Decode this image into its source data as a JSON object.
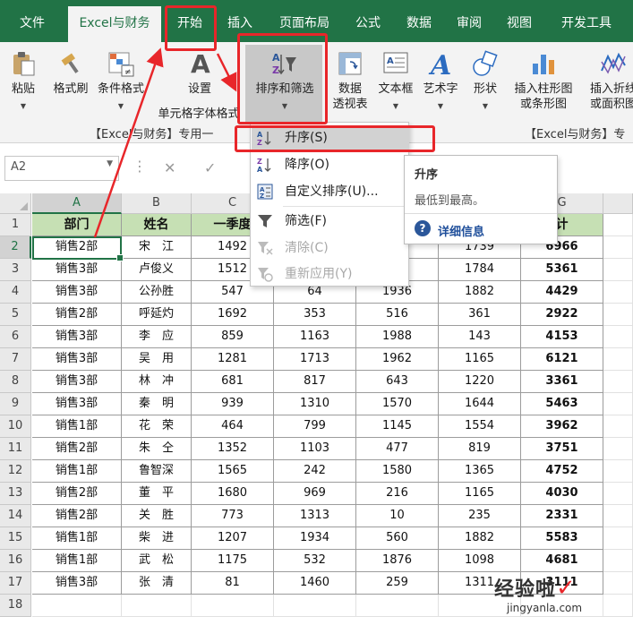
{
  "tabs": [
    {
      "label": "文件",
      "active": false
    },
    {
      "label": "Excel与财务",
      "active": true
    },
    {
      "label": "开始",
      "active": false
    },
    {
      "label": "插入",
      "active": false
    },
    {
      "label": "页面布局",
      "active": false
    },
    {
      "label": "公式",
      "active": false
    },
    {
      "label": "数据",
      "active": false
    },
    {
      "label": "审阅",
      "active": false
    },
    {
      "label": "视图",
      "active": false
    },
    {
      "label": "开发工具",
      "active": false
    }
  ],
  "ribbon": {
    "buttons": [
      {
        "label": "粘贴",
        "icon": "paste-icon",
        "dropdown": true
      },
      {
        "label": "格式刷",
        "icon": "format-painter-icon",
        "dropdown": false
      },
      {
        "label": "条件格式",
        "icon": "conditional-format-icon",
        "dropdown": true
      },
      {
        "label": "设置",
        "label2": "单元格字体格式",
        "icon": "font-format-icon"
      },
      {
        "label": "排序和筛选",
        "icon": "sort-filter-icon",
        "dropdown": true
      },
      {
        "label": "数据",
        "label2": "透视表",
        "icon": "pivot-table-icon"
      },
      {
        "label": "文本框",
        "icon": "textbox-icon",
        "dropdown": true
      },
      {
        "label": "艺术字",
        "icon": "wordart-icon",
        "dropdown": true
      },
      {
        "label": "形状",
        "icon": "shapes-icon",
        "dropdown": true
      },
      {
        "label": "插入柱形图",
        "label2": "或条形图",
        "icon": "bar-chart-icon",
        "dropdown": true
      },
      {
        "label": "插入折线",
        "label2": "或面积图",
        "icon": "line-chart-icon"
      }
    ],
    "group_left": "【Excel与财务】专用一",
    "group_right": "【Excel与财务】专"
  },
  "formula_bar": {
    "name_box": "A2",
    "cancel": "✕",
    "enter": "✓",
    "fx": "fx"
  },
  "sort_menu": {
    "items": [
      {
        "label": "升序(S)",
        "icon": "sort-ascending-icon",
        "disabled": false,
        "hover": true
      },
      {
        "label": "降序(O)",
        "icon": "sort-descending-icon",
        "disabled": false,
        "hover": false
      },
      {
        "label": "自定义排序(U)...",
        "icon": "custom-sort-icon",
        "disabled": false,
        "hover": false
      },
      {
        "label": "筛选(F)",
        "icon": "filter-icon",
        "disabled": false,
        "hover": false
      },
      {
        "label": "清除(C)",
        "icon": "clear-filter-icon",
        "disabled": true,
        "hover": false
      },
      {
        "label": "重新应用(Y)",
        "icon": "reapply-icon",
        "disabled": true,
        "hover": false
      }
    ]
  },
  "tooltip": {
    "title": "升序",
    "desc": "最低到最高。",
    "more": "详细信息"
  },
  "sheet": {
    "columns": [
      "A",
      "B",
      "C",
      "D",
      "E",
      "F",
      "G"
    ],
    "headers": [
      "部门",
      "姓名",
      "一季度",
      "",
      "",
      "",
      "计"
    ],
    "rows": [
      [
        "销售2部",
        "宋　江",
        "1492",
        "",
        "6",
        "1739",
        "6966"
      ],
      [
        "销售3部",
        "卢俊义",
        "1512",
        "",
        "",
        "1784",
        "5361"
      ],
      [
        "销售3部",
        "公孙胜",
        "547",
        "64",
        "1936",
        "1882",
        "4429"
      ],
      [
        "销售2部",
        "呼延灼",
        "1692",
        "353",
        "516",
        "361",
        "2922"
      ],
      [
        "销售3部",
        "李　应",
        "859",
        "1163",
        "1988",
        "143",
        "4153"
      ],
      [
        "销售3部",
        "吴　用",
        "1281",
        "1713",
        "1962",
        "1165",
        "6121"
      ],
      [
        "销售3部",
        "林　冲",
        "681",
        "817",
        "643",
        "1220",
        "3361"
      ],
      [
        "销售3部",
        "秦　明",
        "939",
        "1310",
        "1570",
        "1644",
        "5463"
      ],
      [
        "销售1部",
        "花　荣",
        "464",
        "799",
        "1145",
        "1554",
        "3962"
      ],
      [
        "销售2部",
        "朱　仝",
        "1352",
        "1103",
        "477",
        "819",
        "3751"
      ],
      [
        "销售1部",
        "鲁智深",
        "1565",
        "242",
        "1580",
        "1365",
        "4752"
      ],
      [
        "销售2部",
        "董　平",
        "1680",
        "969",
        "216",
        "1165",
        "4030"
      ],
      [
        "销售2部",
        "关　胜",
        "773",
        "1313",
        "10",
        "235",
        "2331"
      ],
      [
        "销售1部",
        "柴　进",
        "1207",
        "1934",
        "560",
        "1882",
        "5583"
      ],
      [
        "销售1部",
        "武　松",
        "1175",
        "532",
        "1876",
        "1098",
        "4681"
      ],
      [
        "销售3部",
        "张　清",
        "81",
        "1460",
        "259",
        "1311",
        "3111"
      ]
    ],
    "row_numbers": [
      "1",
      "2",
      "3",
      "4",
      "5",
      "6",
      "7",
      "8",
      "9",
      "10",
      "11",
      "12",
      "13",
      "14",
      "15",
      "16",
      "17",
      "18"
    ]
  },
  "watermark": {
    "text": "经验啦",
    "check": "✓",
    "url": "jingyanla.com"
  }
}
